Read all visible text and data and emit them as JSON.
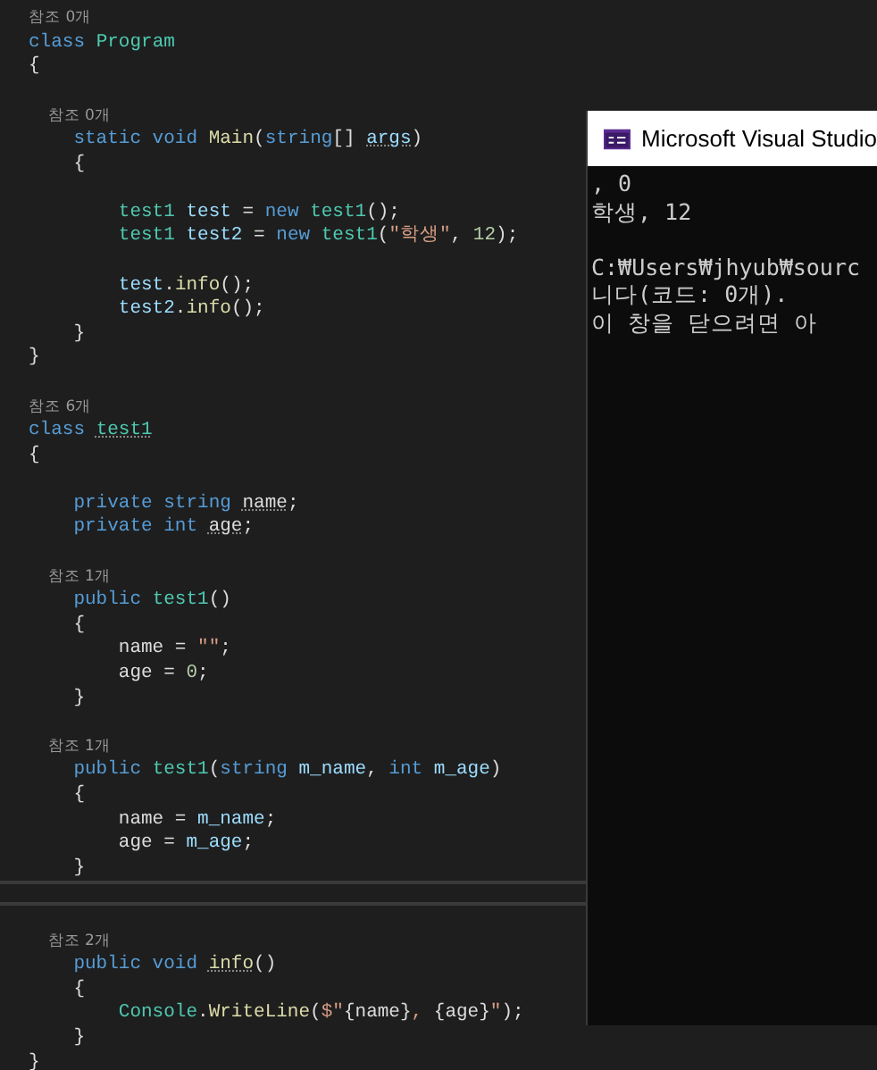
{
  "editor": {
    "lines": [
      {
        "kind": "codelens",
        "text": "참조 0개"
      },
      {
        "kind": "code",
        "tokens": [
          {
            "text": "class ",
            "kind": "kw"
          },
          {
            "text": "Program",
            "kind": "type"
          }
        ]
      },
      {
        "kind": "code",
        "tokens": [
          {
            "text": "{",
            "kind": "punct"
          }
        ]
      },
      {
        "kind": "blank"
      },
      {
        "kind": "codelens",
        "text": "    참조 0개"
      },
      {
        "kind": "code",
        "tokens": [
          {
            "text": "    static void ",
            "kind": "kw"
          },
          {
            "text": "Main",
            "kind": "method"
          },
          {
            "text": "(",
            "kind": "punct"
          },
          {
            "text": "string",
            "kind": "kw"
          },
          {
            "text": "[] ",
            "kind": "punct"
          },
          {
            "text": "args",
            "kind": "param",
            "hint": true
          },
          {
            "text": ")",
            "kind": "punct"
          }
        ]
      },
      {
        "kind": "code",
        "tokens": [
          {
            "text": "    {",
            "kind": "punct"
          }
        ]
      },
      {
        "kind": "blank"
      },
      {
        "kind": "code",
        "tokens": [
          {
            "text": "        test1 ",
            "kind": "type"
          },
          {
            "text": "test",
            "kind": "param"
          },
          {
            "text": " = ",
            "kind": "punct"
          },
          {
            "text": "new ",
            "kind": "kw"
          },
          {
            "text": "test1",
            "kind": "type"
          },
          {
            "text": "();",
            "kind": "punct"
          }
        ]
      },
      {
        "kind": "code",
        "tokens": [
          {
            "text": "        test1 ",
            "kind": "type"
          },
          {
            "text": "test2",
            "kind": "param"
          },
          {
            "text": " = ",
            "kind": "punct"
          },
          {
            "text": "new ",
            "kind": "kw"
          },
          {
            "text": "test1",
            "kind": "type"
          },
          {
            "text": "(",
            "kind": "punct"
          },
          {
            "text": "\"학생\"",
            "kind": "str"
          },
          {
            "text": ", ",
            "kind": "punct"
          },
          {
            "text": "12",
            "kind": "num"
          },
          {
            "text": ");",
            "kind": "punct"
          }
        ]
      },
      {
        "kind": "blank"
      },
      {
        "kind": "code",
        "tokens": [
          {
            "text": "        test",
            "kind": "param"
          },
          {
            "text": ".",
            "kind": "punct"
          },
          {
            "text": "info",
            "kind": "method"
          },
          {
            "text": "();",
            "kind": "punct"
          }
        ]
      },
      {
        "kind": "code",
        "tokens": [
          {
            "text": "        test2",
            "kind": "param"
          },
          {
            "text": ".",
            "kind": "punct"
          },
          {
            "text": "info",
            "kind": "method"
          },
          {
            "text": "();",
            "kind": "punct"
          }
        ]
      },
      {
        "kind": "code",
        "tokens": [
          {
            "text": "    }",
            "kind": "punct"
          }
        ]
      },
      {
        "kind": "code",
        "tokens": [
          {
            "text": "}",
            "kind": "punct"
          }
        ]
      },
      {
        "kind": "blank"
      },
      {
        "kind": "codelens",
        "text": "참조 6개"
      },
      {
        "kind": "code",
        "tokens": [
          {
            "text": "class ",
            "kind": "kw"
          },
          {
            "text": "test1",
            "kind": "type",
            "hint": true
          }
        ]
      },
      {
        "kind": "code",
        "tokens": [
          {
            "text": "{",
            "kind": "punct"
          }
        ]
      },
      {
        "kind": "blank"
      },
      {
        "kind": "code",
        "tokens": [
          {
            "text": "    private string ",
            "kind": "kw"
          },
          {
            "text": "name",
            "kind": "field",
            "hint": true
          },
          {
            "text": ";",
            "kind": "punct"
          }
        ]
      },
      {
        "kind": "code",
        "tokens": [
          {
            "text": "    private int ",
            "kind": "kw"
          },
          {
            "text": "age",
            "kind": "field",
            "hint": true
          },
          {
            "text": ";",
            "kind": "punct"
          }
        ]
      },
      {
        "kind": "blank"
      },
      {
        "kind": "codelens",
        "text": "    참조 1개"
      },
      {
        "kind": "code",
        "tokens": [
          {
            "text": "    public ",
            "kind": "kw"
          },
          {
            "text": "test1",
            "kind": "type"
          },
          {
            "text": "()",
            "kind": "punct"
          }
        ]
      },
      {
        "kind": "code",
        "tokens": [
          {
            "text": "    {",
            "kind": "punct"
          }
        ]
      },
      {
        "kind": "code",
        "tokens": [
          {
            "text": "        name",
            "kind": "field"
          },
          {
            "text": " = ",
            "kind": "punct"
          },
          {
            "text": "\"\"",
            "kind": "str"
          },
          {
            "text": ";",
            "kind": "punct"
          }
        ]
      },
      {
        "kind": "code",
        "tokens": [
          {
            "text": "        age",
            "kind": "field"
          },
          {
            "text": " = ",
            "kind": "punct"
          },
          {
            "text": "0",
            "kind": "num"
          },
          {
            "text": ";",
            "kind": "punct"
          }
        ]
      },
      {
        "kind": "code",
        "tokens": [
          {
            "text": "    }",
            "kind": "punct"
          }
        ]
      },
      {
        "kind": "blank"
      },
      {
        "kind": "codelens",
        "text": "    참조 1개"
      },
      {
        "kind": "code",
        "tokens": [
          {
            "text": "    public ",
            "kind": "kw"
          },
          {
            "text": "test1",
            "kind": "type"
          },
          {
            "text": "(",
            "kind": "punct"
          },
          {
            "text": "string ",
            "kind": "kw"
          },
          {
            "text": "m_name",
            "kind": "param"
          },
          {
            "text": ", ",
            "kind": "punct"
          },
          {
            "text": "int ",
            "kind": "kw"
          },
          {
            "text": "m_age",
            "kind": "param"
          },
          {
            "text": ")",
            "kind": "punct"
          }
        ]
      },
      {
        "kind": "code",
        "tokens": [
          {
            "text": "    {",
            "kind": "punct"
          }
        ]
      },
      {
        "kind": "code",
        "tokens": [
          {
            "text": "        name",
            "kind": "field"
          },
          {
            "text": " = ",
            "kind": "punct"
          },
          {
            "text": "m_name",
            "kind": "param"
          },
          {
            "text": ";",
            "kind": "punct"
          }
        ]
      },
      {
        "kind": "code",
        "tokens": [
          {
            "text": "        age",
            "kind": "field"
          },
          {
            "text": " = ",
            "kind": "punct"
          },
          {
            "text": "m_age",
            "kind": "param"
          },
          {
            "text": ";",
            "kind": "punct"
          }
        ]
      },
      {
        "kind": "code",
        "tokens": [
          {
            "text": "    }",
            "kind": "punct"
          }
        ]
      },
      {
        "kind": "separator"
      },
      {
        "kind": "blank"
      },
      {
        "kind": "codelens",
        "text": "    참조 2개"
      },
      {
        "kind": "code",
        "tokens": [
          {
            "text": "    public void ",
            "kind": "kw"
          },
          {
            "text": "info",
            "kind": "method",
            "hint": true
          },
          {
            "text": "()",
            "kind": "punct"
          }
        ]
      },
      {
        "kind": "code",
        "tokens": [
          {
            "text": "    {",
            "kind": "punct"
          }
        ]
      },
      {
        "kind": "code",
        "tokens": [
          {
            "text": "        Console",
            "kind": "type"
          },
          {
            "text": ".",
            "kind": "punct"
          },
          {
            "text": "WriteLine",
            "kind": "method"
          },
          {
            "text": "(",
            "kind": "punct"
          },
          {
            "text": "$\"",
            "kind": "str"
          },
          {
            "text": "{name}",
            "kind": "field"
          },
          {
            "text": ", ",
            "kind": "str"
          },
          {
            "text": "{age}",
            "kind": "field"
          },
          {
            "text": "\"",
            "kind": "str"
          },
          {
            "text": ");",
            "kind": "punct"
          }
        ]
      },
      {
        "kind": "code",
        "tokens": [
          {
            "text": "    }",
            "kind": "punct"
          }
        ]
      },
      {
        "kind": "code",
        "tokens": [
          {
            "text": "}",
            "kind": "punct"
          }
        ]
      }
    ]
  },
  "console": {
    "title": "Microsoft Visual Studio",
    "lines": [
      {
        "kind": "text",
        "text": ", 0"
      },
      {
        "kind": "text",
        "text": "학생, 12"
      },
      {
        "kind": "blank"
      },
      {
        "kind": "text",
        "text": "C:₩Users₩jhyub₩sourc"
      },
      {
        "kind": "text",
        "text": "니다(코드: 0개)."
      },
      {
        "kind": "text",
        "text": "이 창을 닫으려면 아"
      }
    ]
  }
}
